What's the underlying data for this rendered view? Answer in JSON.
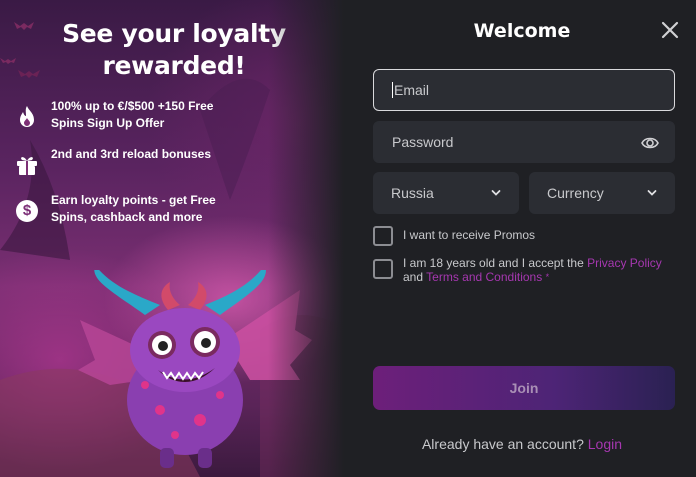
{
  "promo": {
    "title": "See your loyalty rewarded!",
    "perks": [
      {
        "icon": "flame-icon",
        "text": "100% up to €/$500 +150 Free Spins Sign Up Offer"
      },
      {
        "icon": "gift-icon",
        "text": "2nd and 3rd reload bonuses"
      },
      {
        "icon": "dollar-coin-icon",
        "text": "Earn loyalty points - get Free Spins, cashback and more"
      }
    ],
    "coin_symbol": "$"
  },
  "form": {
    "title": "Welcome",
    "email_placeholder": "Email",
    "password_placeholder": "Password",
    "country_value": "Russia",
    "currency_placeholder": "Currency",
    "promos_label": "I want to receive Promos",
    "terms_prefix": "I am 18 years old and I accept the",
    "privacy_link": "Privacy Policy",
    "terms_and": "and",
    "terms_link": "Terms and Conditions",
    "required_mark": "*",
    "join_label": "Join",
    "signin_text": "Already have an account?",
    "login_link": "Login"
  },
  "colors": {
    "accent": "#a637b0",
    "panel_bg": "#1f2024",
    "field_bg": "#2b2d33"
  }
}
